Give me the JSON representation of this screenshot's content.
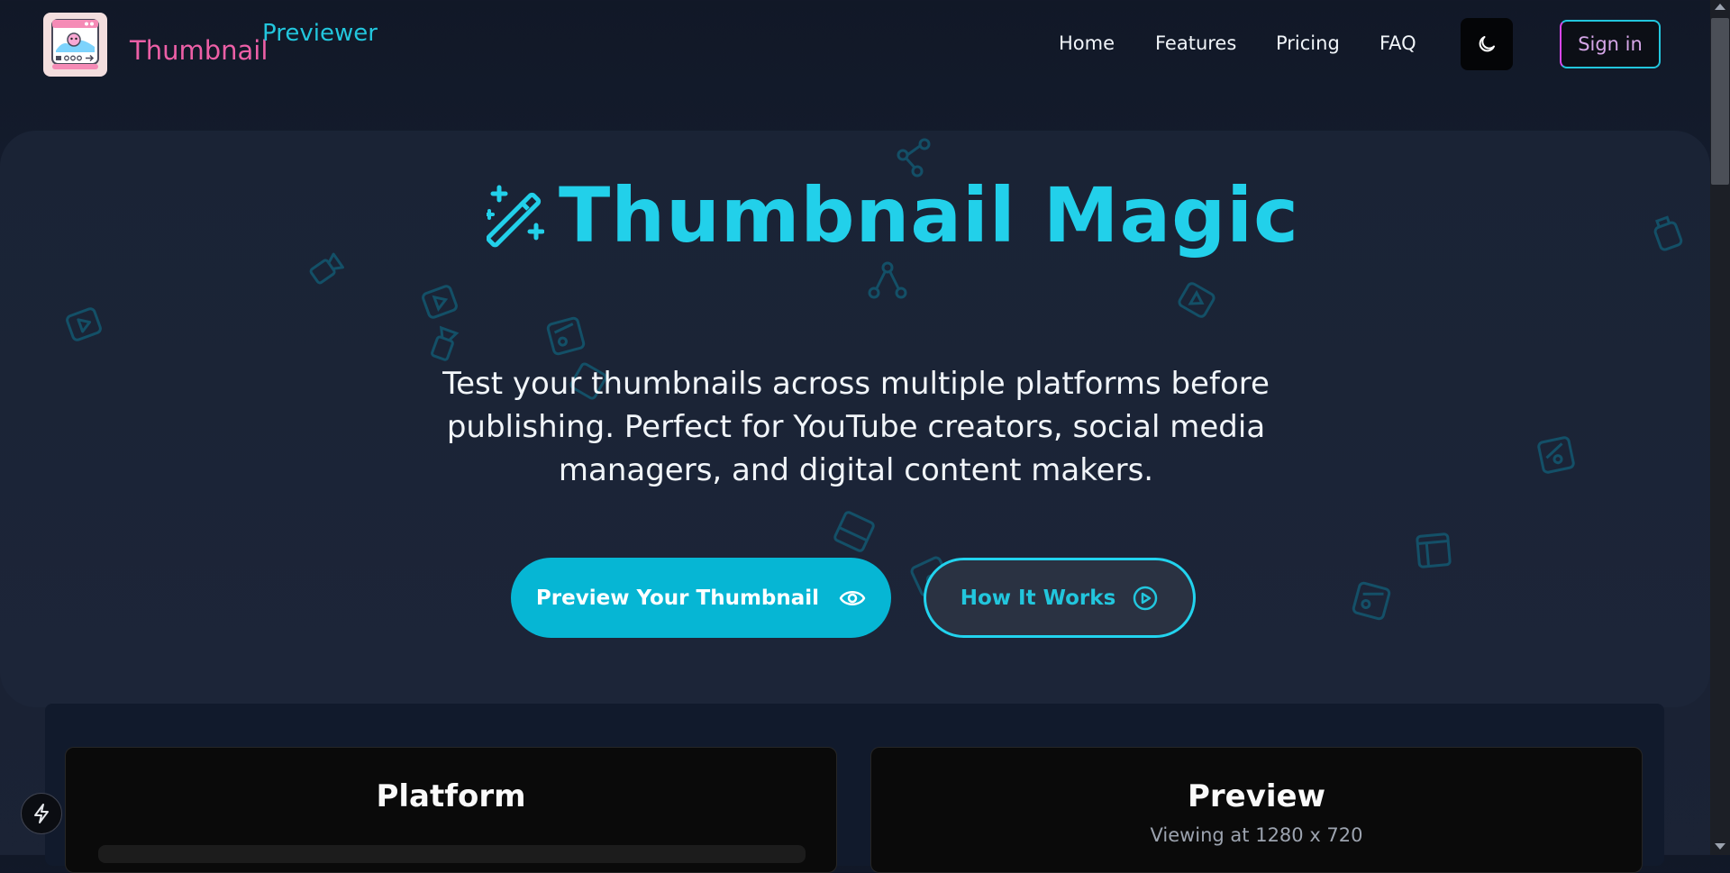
{
  "header": {
    "brand_part1": "Thumbnail",
    "brand_part2": "Previewer",
    "nav": [
      "Home",
      "Features",
      "Pricing",
      "FAQ"
    ],
    "theme_icon": "moon-icon",
    "signin_label": "Sign in"
  },
  "hero": {
    "title": "Thumbnail Magic",
    "title_icon": "magic-wand-icon",
    "subtitle": "Test your thumbnails across multiple platforms before publishing. Perfect for YouTube creators, social media managers, and digital content makers.",
    "primary_button": "Preview Your Thumbnail",
    "primary_icon": "eye-icon",
    "secondary_button": "How It Works",
    "secondary_icon": "play-circle-icon"
  },
  "panels": {
    "platform_title": "Platform",
    "preview_title": "Preview",
    "preview_sub": "Viewing at 1280 x 720"
  },
  "colors": {
    "accent_cyan": "#22d0ea",
    "accent_pink": "#ec5fa6",
    "background": "#111827"
  }
}
